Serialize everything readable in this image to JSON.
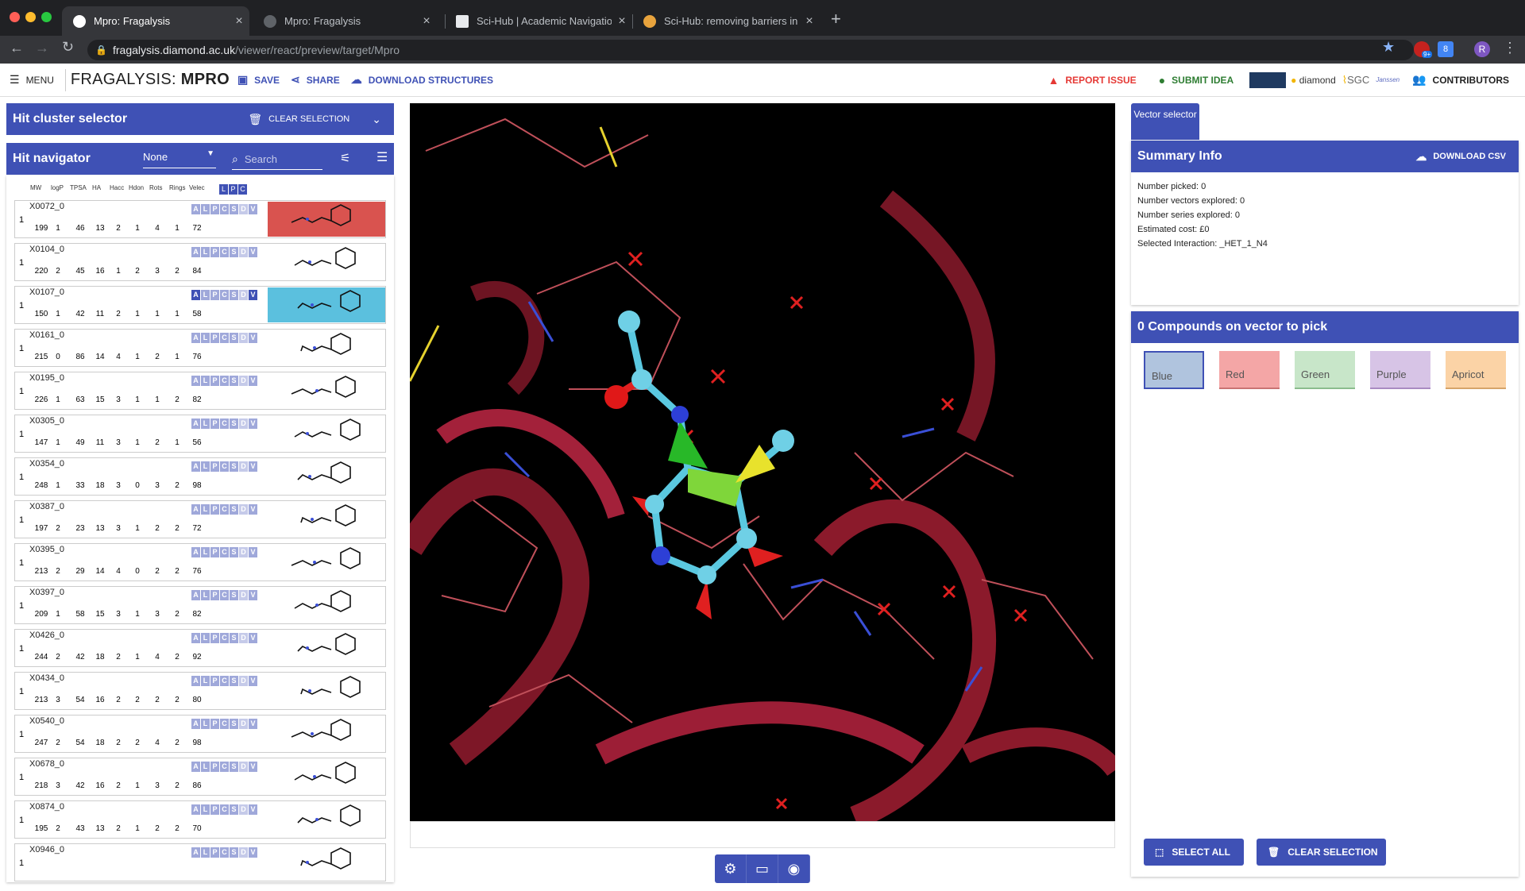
{
  "browser": {
    "tabs": [
      {
        "title": "Mpro: Fragalysis",
        "active": true
      },
      {
        "title": "Mpro: Fragalysis",
        "active": false
      },
      {
        "title": "Sci-Hub | Academic Navigation",
        "active": false
      },
      {
        "title": "Sci-Hub: removing barriers in t",
        "active": false
      }
    ],
    "url_host": "fragalysis.diamond.ac.uk",
    "url_path": "/viewer/react/preview/target/Mpro",
    "profile_initial": "R",
    "ext_badge": "9+",
    "ext_number": "8"
  },
  "header": {
    "menu_label": "MENU",
    "brand_prefix": "FRAGALYSIS: ",
    "brand_target": "MPRO",
    "save_label": "SAVE",
    "share_label": "SHARE",
    "download_label": "DOWNLOAD STRUCTURES",
    "report_label": "REPORT ISSUE",
    "idea_label": "SUBMIT IDEA",
    "logos": [
      "diamond",
      "SGC",
      "Janssen"
    ],
    "contributors_label": "CONTRIBUTORS",
    "report_color": "#e53935",
    "idea_color": "#2e7d32"
  },
  "hit_cluster": {
    "title": "Hit cluster selector",
    "clear_label": "CLEAR SELECTION"
  },
  "hit_nav": {
    "title": "Hit navigator",
    "select_value": "None",
    "search_placeholder": "Search",
    "columns": [
      "MW",
      "logP",
      "TPSA",
      "HA",
      "Hacc",
      "Hdon",
      "Rots",
      "Rings",
      "Velec"
    ],
    "header_flags": [
      "L",
      "P",
      "C"
    ],
    "flag_letters": [
      "A",
      "L",
      "P",
      "C",
      "S",
      "D",
      "V"
    ],
    "rows": [
      {
        "num": "1",
        "code": "X0072_0",
        "stats": [
          "199",
          "1",
          "46",
          "13",
          "2",
          "1",
          "4",
          "1",
          "72"
        ],
        "highlight": "#d9534f"
      },
      {
        "num": "1",
        "code": "X0104_0",
        "stats": [
          "220",
          "2",
          "45",
          "16",
          "1",
          "2",
          "3",
          "2",
          "84"
        ],
        "highlight": ""
      },
      {
        "num": "1",
        "code": "X0107_0",
        "stats": [
          "150",
          "1",
          "42",
          "11",
          "2",
          "1",
          "1",
          "1",
          "58"
        ],
        "highlight": "#5bc0de"
      },
      {
        "num": "1",
        "code": "X0161_0",
        "stats": [
          "215",
          "0",
          "86",
          "14",
          "4",
          "1",
          "2",
          "1",
          "76"
        ],
        "highlight": ""
      },
      {
        "num": "1",
        "code": "X0195_0",
        "stats": [
          "226",
          "1",
          "63",
          "15",
          "3",
          "1",
          "1",
          "2",
          "82"
        ],
        "highlight": ""
      },
      {
        "num": "1",
        "code": "X0305_0",
        "stats": [
          "147",
          "1",
          "49",
          "11",
          "3",
          "1",
          "2",
          "1",
          "56"
        ],
        "highlight": ""
      },
      {
        "num": "1",
        "code": "X0354_0",
        "stats": [
          "248",
          "1",
          "33",
          "18",
          "3",
          "0",
          "3",
          "2",
          "98"
        ],
        "highlight": ""
      },
      {
        "num": "1",
        "code": "X0387_0",
        "stats": [
          "197",
          "2",
          "23",
          "13",
          "3",
          "1",
          "2",
          "2",
          "72"
        ],
        "highlight": ""
      },
      {
        "num": "1",
        "code": "X0395_0",
        "stats": [
          "213",
          "2",
          "29",
          "14",
          "4",
          "0",
          "2",
          "2",
          "76"
        ],
        "highlight": ""
      },
      {
        "num": "1",
        "code": "X0397_0",
        "stats": [
          "209",
          "1",
          "58",
          "15",
          "3",
          "1",
          "3",
          "2",
          "82"
        ],
        "highlight": ""
      },
      {
        "num": "1",
        "code": "X0426_0",
        "stats": [
          "244",
          "2",
          "42",
          "18",
          "2",
          "1",
          "4",
          "2",
          "92"
        ],
        "highlight": ""
      },
      {
        "num": "1",
        "code": "X0434_0",
        "stats": [
          "213",
          "3",
          "54",
          "16",
          "2",
          "2",
          "2",
          "2",
          "80"
        ],
        "highlight": ""
      },
      {
        "num": "1",
        "code": "X0540_0",
        "stats": [
          "247",
          "2",
          "54",
          "18",
          "2",
          "2",
          "4",
          "2",
          "98"
        ],
        "highlight": ""
      },
      {
        "num": "1",
        "code": "X0678_0",
        "stats": [
          "218",
          "3",
          "42",
          "16",
          "2",
          "1",
          "3",
          "2",
          "86"
        ],
        "highlight": ""
      },
      {
        "num": "1",
        "code": "X0874_0",
        "stats": [
          "195",
          "2",
          "43",
          "13",
          "2",
          "1",
          "2",
          "2",
          "70"
        ],
        "highlight": ""
      },
      {
        "num": "1",
        "code": "X0946_0",
        "stats": [
          "",
          "",
          "",
          "",
          "",
          "",
          "",
          "",
          ""
        ],
        "highlight": ""
      }
    ]
  },
  "right": {
    "vector_tab": "Vector selector",
    "summary_title": "Summary Info",
    "download_csv": "DOWNLOAD CSV",
    "summary_lines": [
      "Number picked: 0",
      "Number vectors explored: 0",
      "Number series explored: 0",
      "Estimated cost: £0",
      "Selected Interaction: _HET_1_N4"
    ],
    "compounds_title": "0 Compounds on vector to pick",
    "swatches": [
      {
        "label": "Blue",
        "color": "#b0c4de"
      },
      {
        "label": "Red",
        "color": "#f4a6a6"
      },
      {
        "label": "Green",
        "color": "#c8e6c9"
      },
      {
        "label": "Purple",
        "color": "#d7c4e6"
      },
      {
        "label": "Apricot",
        "color": "#fbd3a6"
      }
    ],
    "select_all": "SELECT ALL",
    "clear_selection": "CLEAR SELECTION"
  },
  "viewer_tools": [
    "settings-icon",
    "display-icon",
    "mouse-icon"
  ]
}
